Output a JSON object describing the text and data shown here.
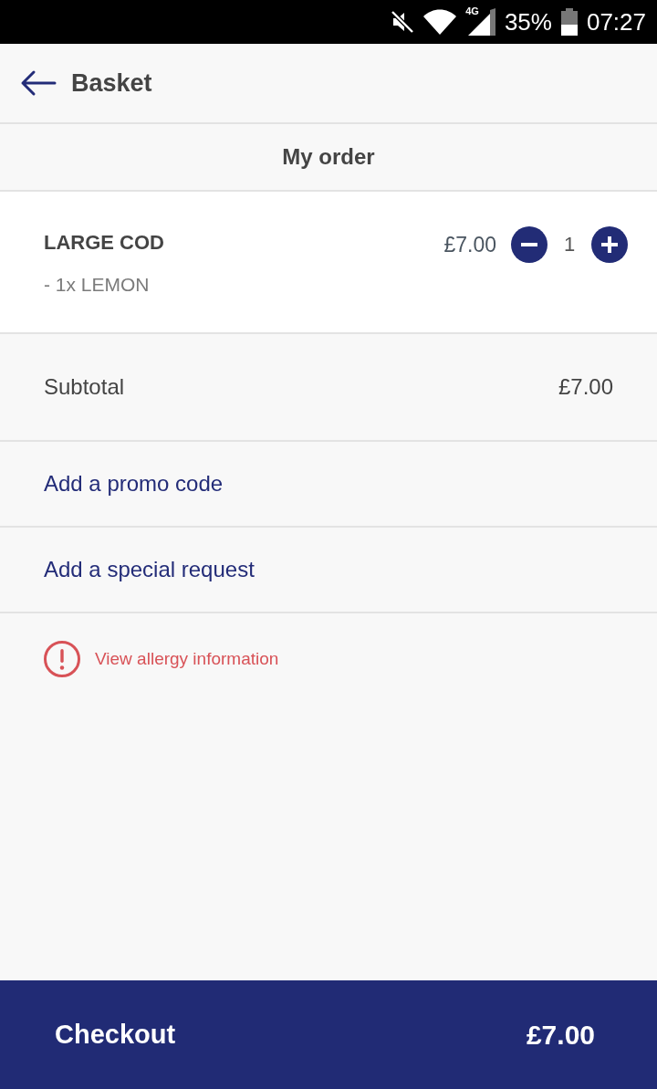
{
  "status_bar": {
    "network_type": "4G",
    "battery_percent": "35%",
    "time": "07:27"
  },
  "app_bar": {
    "title": "Basket"
  },
  "section_header": {
    "title": "My order"
  },
  "items": [
    {
      "name": "LARGE COD",
      "options": [
        "- 1x LEMON"
      ],
      "price": "£7.00",
      "quantity": "1"
    }
  ],
  "subtotal": {
    "label": "Subtotal",
    "value": "£7.00"
  },
  "actions": [
    {
      "label": "Add a promo code"
    },
    {
      "label": "Add a special request"
    }
  ],
  "allergy": {
    "label": "View allergy information"
  },
  "checkout": {
    "label": "Checkout",
    "total": "£7.00"
  }
}
